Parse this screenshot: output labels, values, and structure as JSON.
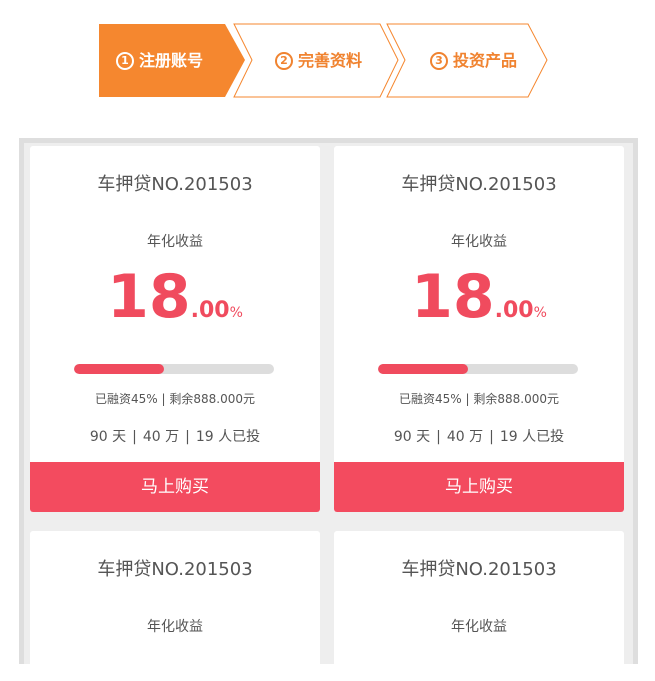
{
  "steps": [
    {
      "num": "1",
      "label": "注册账号",
      "active": true
    },
    {
      "num": "2",
      "label": "完善资料",
      "active": false
    },
    {
      "num": "3",
      "label": "投资产品",
      "active": false
    }
  ],
  "colors": {
    "accent_orange": "#f5872f",
    "accent_red": "#f34b5f",
    "board_bg": "#eeeeee"
  },
  "cards": [
    {
      "title": "车押贷NO.201503",
      "rate_label": "年化收益",
      "rate_int": "18",
      "rate_dec": ".00",
      "rate_unit": "%",
      "progress": 0.45,
      "funded_text": "已融资45%",
      "meta_sep": "|",
      "remaining_text": "剩余888.000元",
      "days": "90",
      "days_unit": "天",
      "amount": "40",
      "amount_unit": "万",
      "investors": "19",
      "investors_unit": "人已投",
      "buy_label": "马上购买"
    },
    {
      "title": "车押贷NO.201503",
      "rate_label": "年化收益",
      "rate_int": "18",
      "rate_dec": ".00",
      "rate_unit": "%",
      "progress": 0.45,
      "funded_text": "已融资45%",
      "meta_sep": "|",
      "remaining_text": "剩余888.000元",
      "days": "90",
      "days_unit": "天",
      "amount": "40",
      "amount_unit": "万",
      "investors": "19",
      "investors_unit": "人已投",
      "buy_label": "马上购买"
    },
    {
      "title": "车押贷NO.201503",
      "rate_label": "年化收益"
    },
    {
      "title": "车押贷NO.201503",
      "rate_label": "年化收益"
    }
  ]
}
